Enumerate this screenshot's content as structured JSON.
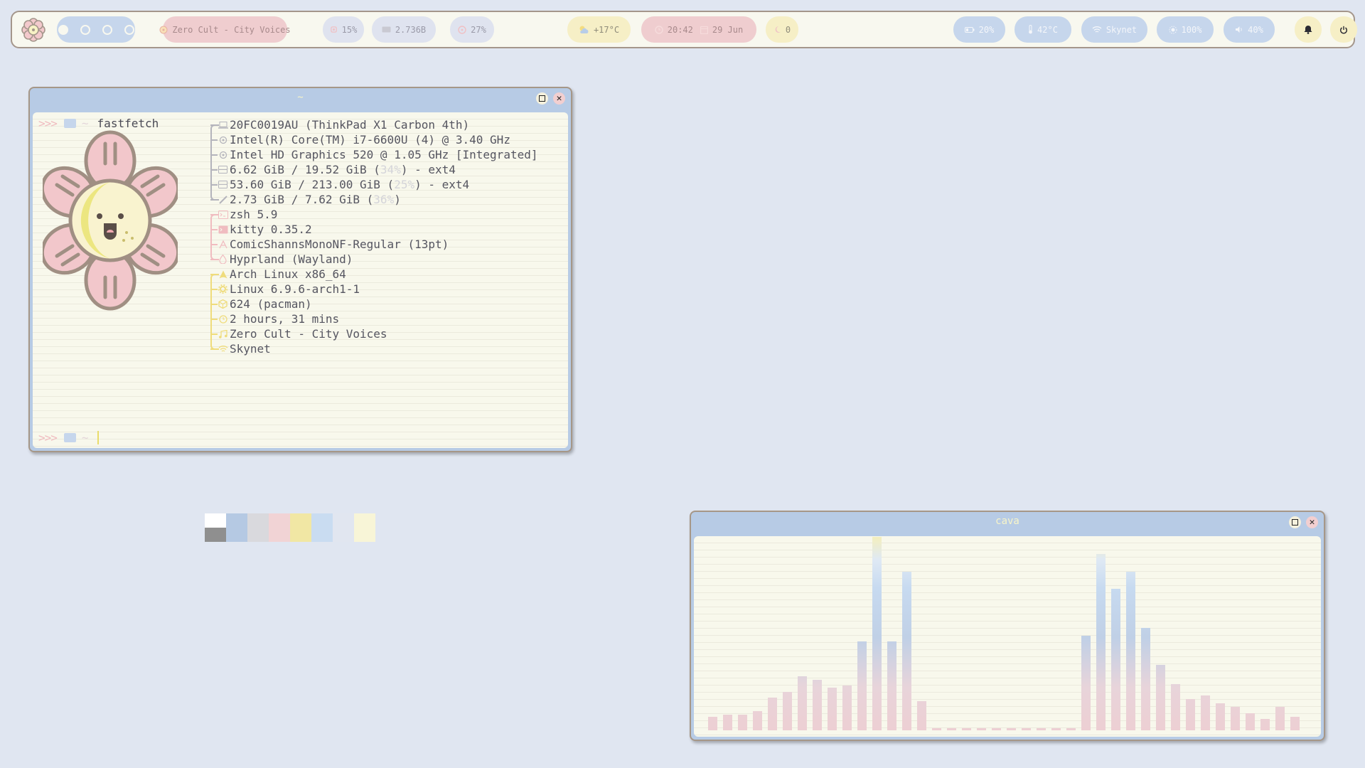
{
  "topbar": {
    "workspaces": [
      {
        "active": true
      },
      {
        "active": false
      },
      {
        "active": false
      },
      {
        "active": false
      }
    ],
    "media": "Zero Cult - City Voices",
    "cpu": "15%",
    "memory": "2.736B",
    "disk": "27%",
    "weather": "+17°C",
    "time": "20:42",
    "date": "29 Jun",
    "idle_count": "0",
    "battery": "20%",
    "temperature": "42°C",
    "network": "Skynet",
    "brightness": "100%",
    "volume": "40%"
  },
  "terminal": {
    "title": "~",
    "command_prompt": {
      "arrows": ">>>",
      "dir": "~",
      "command": "fastfetch"
    },
    "second_prompt": {
      "arrows": ">>>",
      "dir": "~"
    },
    "hardware": [
      {
        "icon": "laptop-icon",
        "text": "20FC0019AU (ThinkPad X1 Carbon 4th)"
      },
      {
        "icon": "cpu-icon",
        "text": "Intel(R) Core(TM) i7-6600U (4) @ 3.40 GHz"
      },
      {
        "icon": "gpu-icon",
        "text": "Intel HD Graphics 520 @ 1.05 GHz [Integrated]"
      },
      {
        "icon": "disk-icon",
        "pre": "6.62 GiB / 19.52 GiB (",
        "pct": "34%",
        "post": ") - ext4"
      },
      {
        "icon": "disk-icon",
        "pre": "53.60 GiB / 213.00 GiB (",
        "pct": "25%",
        "post": ") - ext4"
      },
      {
        "icon": "memory-icon",
        "pre": "2.73 GiB / 7.62 GiB (",
        "pct": "36%",
        "post": ")"
      }
    ],
    "software": [
      {
        "icon": "shell-icon",
        "text": "zsh 5.9"
      },
      {
        "icon": "terminal-icon",
        "text": "kitty 0.35.2"
      },
      {
        "icon": "font-icon",
        "text": "ComicShannsMonoNF-Regular (13pt)"
      },
      {
        "icon": "wm-icon",
        "text": "Hyprland (Wayland)"
      }
    ],
    "system": [
      {
        "icon": "arch-icon",
        "text": "Arch Linux x86_64"
      },
      {
        "icon": "kernel-icon",
        "text": "Linux 6.9.6-arch1-1"
      },
      {
        "icon": "package-icon",
        "text": "624 (pacman)"
      },
      {
        "icon": "clock-icon",
        "text": "2 hours, 31 mins"
      },
      {
        "icon": "music-icon",
        "text": "Zero Cult - City Voices"
      },
      {
        "icon": "wifi-icon",
        "text": "Skynet"
      }
    ],
    "palette_top": [
      "#ffffff",
      "#b5c9e3",
      "#d9d9dd",
      "#f1d3d5",
      "#f1e7a4",
      "#c9dcf1",
      "#e1e6f0",
      "#f8f5d7"
    ],
    "palette_bottom": [
      "#8f8f8f",
      "#b5c9e3",
      "#d9d9dd",
      "#f1d3d5",
      "#f1e7a4",
      "#c9dcf1",
      "#e1e6f0",
      "#f8f5d7"
    ]
  },
  "cava": {
    "title": "cava",
    "levels": [
      0.07,
      0.08,
      0.08,
      0.1,
      0.17,
      0.2,
      0.28,
      0.26,
      0.22,
      0.23,
      0.46,
      1.0,
      0.46,
      0.82,
      0.15,
      0.01,
      0.01,
      0.01,
      0.01,
      0.01,
      0.01,
      0.01,
      0.01,
      0.01,
      0.01,
      0.49,
      0.91,
      0.73,
      0.82,
      0.53,
      0.34,
      0.24,
      0.16,
      0.18,
      0.14,
      0.12,
      0.09,
      0.06,
      0.12,
      0.07
    ]
  },
  "colors": {
    "background": "#e0e6f1",
    "bar_bg": "#f8f8ef",
    "accent_blue": "#b7cbe5",
    "accent_pink": "#efcdcf",
    "accent_yellow": "#f6efc6",
    "hw_branch": "#b4b4bc",
    "sw_branch": "#f0bcc0",
    "sys_branch": "#efdc7c"
  }
}
